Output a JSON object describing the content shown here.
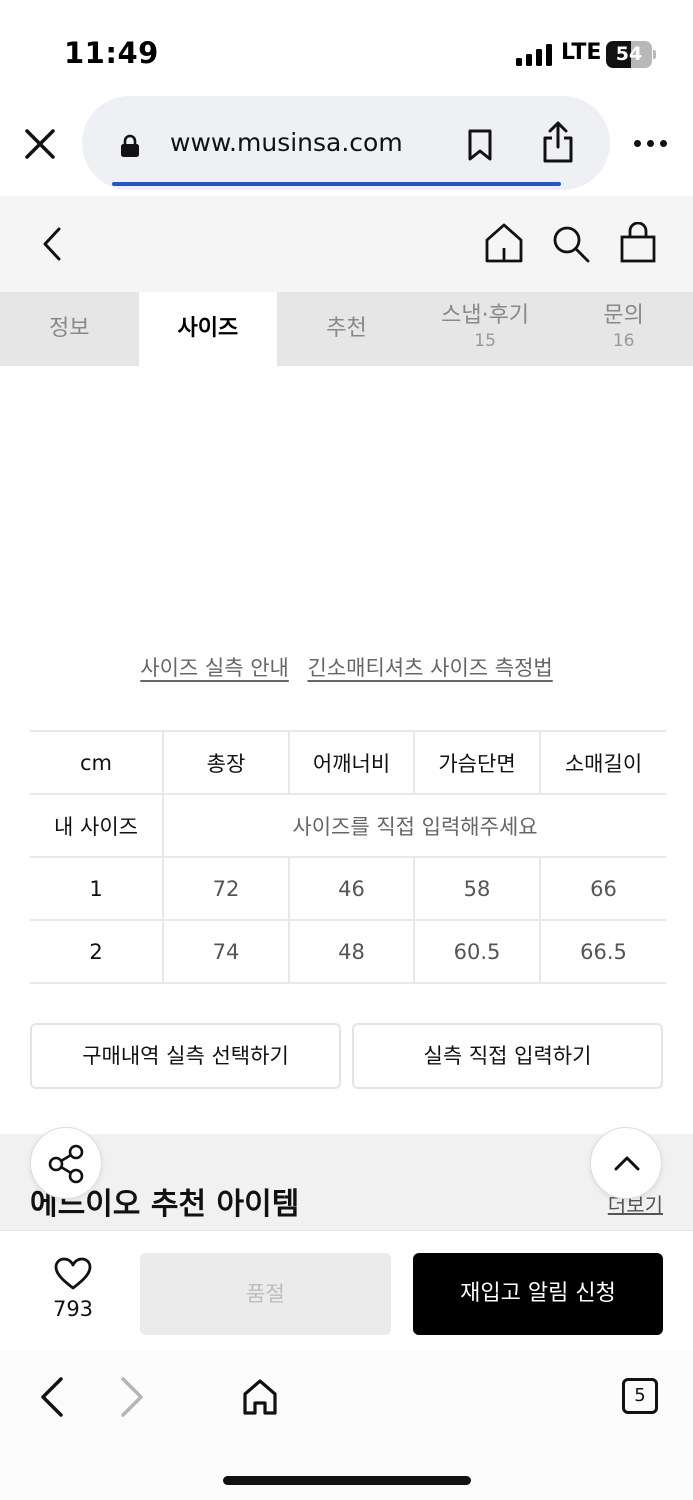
{
  "status_bar": {
    "time": "11:49",
    "network": "LTE",
    "battery_percent": "54",
    "battery_level": 0.54
  },
  "browser": {
    "url": "www.musinsa.com",
    "load_progress": 0.85,
    "icons": [
      "close-icon",
      "lock-icon",
      "bookmark-icon",
      "share-icon",
      "more-icon"
    ]
  },
  "app_header": {
    "icons": [
      "back-icon",
      "home-icon",
      "search-icon",
      "cart-icon"
    ]
  },
  "tabs": [
    {
      "label": "정보",
      "count": ""
    },
    {
      "label": "사이즈",
      "count": ""
    },
    {
      "label": "추천",
      "count": ""
    },
    {
      "label": "스냅·후기",
      "count": "15"
    },
    {
      "label": "문의",
      "count": "16"
    }
  ],
  "active_tab": "사이즈",
  "guide_links": [
    "사이즈 실측 안내",
    "긴소매티셔츠 사이즈 측정법"
  ],
  "size_table": {
    "unit": "cm",
    "columns": [
      "총장",
      "어깨너비",
      "가슴단면",
      "소매길이"
    ],
    "my_size_label": "내 사이즈",
    "my_size_placeholder": "사이즈를 직접 입력해주세요",
    "rows": [
      {
        "size": "1",
        "values": [
          "72",
          "46",
          "58",
          "66"
        ]
      },
      {
        "size": "2",
        "values": [
          "74",
          "48",
          "60.5",
          "66.5"
        ]
      }
    ]
  },
  "actions": {
    "purchase_history_label": "구매내역 실측 선택하기",
    "manual_input_label": "실측 직접 입력하기"
  },
  "recommend": {
    "title": "에드이오 추천 아이템",
    "more_label": "더보기"
  },
  "purchase_bar": {
    "like_count": "793",
    "soldout_label": "품절",
    "restock_label": "재입고 알림 신청"
  },
  "browser_bottom": {
    "tab_count": "5"
  },
  "colors": {
    "accent_blue": "#1f57d6",
    "restock_button": "#000000",
    "soldout_button": "#ebebeb",
    "tab_bar": "#e6e6e6"
  }
}
